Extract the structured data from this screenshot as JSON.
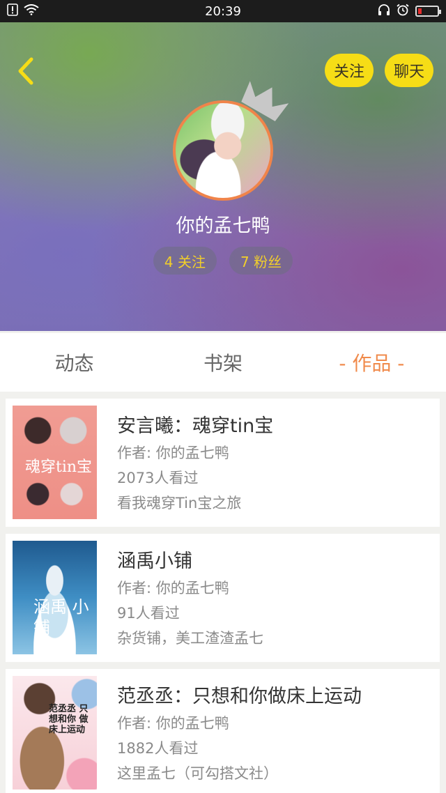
{
  "status_bar": {
    "time": "20:39",
    "left_icons": [
      "sim-icon",
      "wifi-icon"
    ],
    "right_icons": [
      "headphones-icon",
      "alarm-icon",
      "battery-icon"
    ],
    "battery_color": "#e52b2b"
  },
  "header": {
    "follow_label": "关注",
    "chat_label": "聊天",
    "username": "你的孟七鸭",
    "following": "4 关注",
    "fans": "7 粉丝",
    "accent": "#f6dd16",
    "avatar_ring_color": "#f0844a"
  },
  "tabs": [
    {
      "label": "动态",
      "active": false
    },
    {
      "label": "书架",
      "active": false
    },
    {
      "label": "- 作品 -",
      "active": true
    }
  ],
  "works": [
    {
      "title": "安言曦：魂穿tin宝",
      "author": "作者: 你的孟七鸭",
      "views": "2073人看过",
      "desc": "看我魂穿Tin宝之旅",
      "cover_text": "魂穿tin宝"
    },
    {
      "title": "涵禹小铺",
      "author": "作者: 你的孟七鸭",
      "views": "91人看过",
      "desc": "杂货铺，美工渣渣孟七",
      "cover_text": "涵禹 小铺"
    },
    {
      "title": "范丞丞：只想和你做床上运动",
      "author": "作者: 你的孟七鸭",
      "views": "1882人看过",
      "desc": "这里孟七（可勾搭文社）",
      "cover_text": "范丞丞 只想和你 做床上运动"
    }
  ]
}
